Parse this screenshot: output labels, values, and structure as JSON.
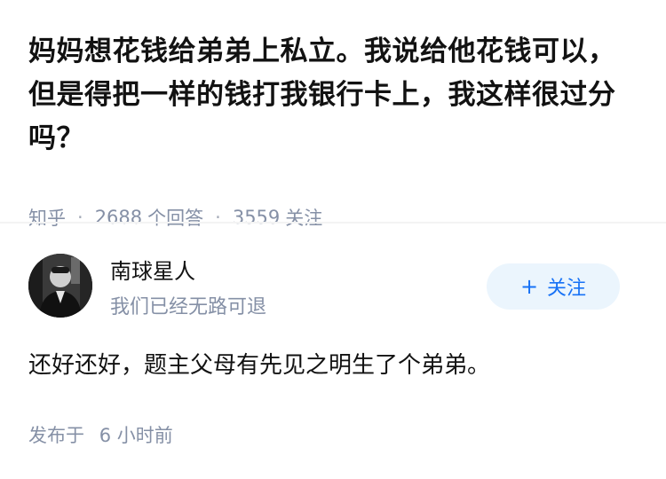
{
  "question": {
    "title": "妈妈想花钱给弟弟上私立。我说给他花钱可以，但是得把一样的钱打我银行卡上，我这样很过分吗？",
    "source": "知乎",
    "answer_count": "2688",
    "answer_label": "个回答",
    "follower_count": "3559",
    "follower_label": "关注"
  },
  "author": {
    "name": "南球星人",
    "bio": "我们已经无路可退",
    "follow_label": "关注",
    "follow_plus": "+"
  },
  "answer": {
    "content": "还好还好，题主父母有先见之明生了个弟弟。",
    "published_label": "发布于",
    "published_time": "6 小时前"
  },
  "colors": {
    "accent": "#1772f6",
    "follow_bg": "#ebf5fd",
    "meta_gray": "#8590a6",
    "text": "#121212"
  }
}
